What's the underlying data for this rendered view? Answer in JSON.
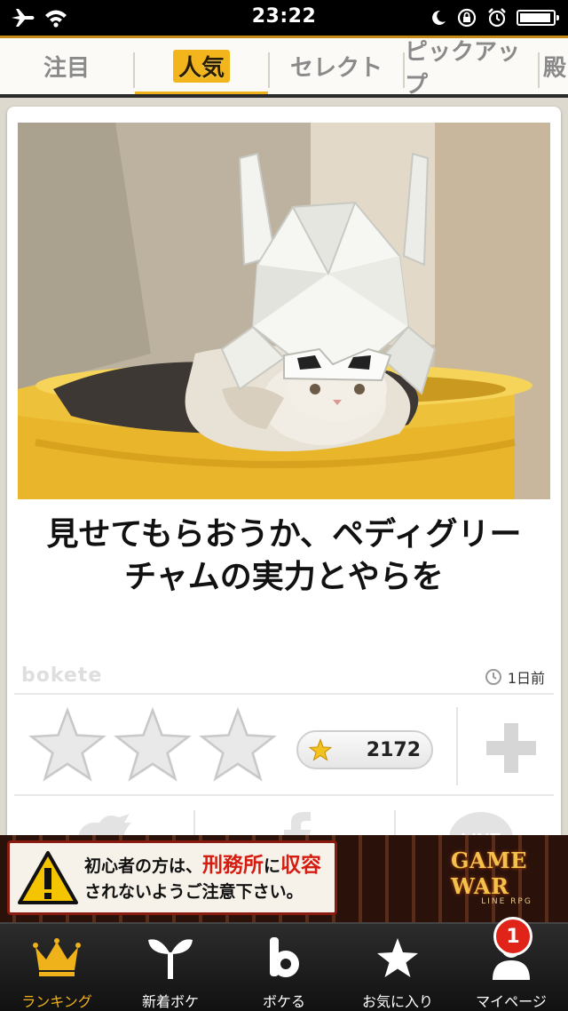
{
  "status_bar": {
    "time": "23:22",
    "icons": [
      "airplane-icon",
      "wifi-icon",
      "moon-icon",
      "rotation-lock-icon",
      "alarm-icon",
      "battery-icon"
    ]
  },
  "top_tabs": {
    "items": [
      {
        "label": "注目",
        "active": false
      },
      {
        "label": "人気",
        "active": true
      },
      {
        "label": "セレクト",
        "active": false
      },
      {
        "label": "ピックアップ",
        "active": false
      },
      {
        "label": "殿",
        "active": false
      }
    ]
  },
  "post": {
    "image_alt": "cat wearing a folded paper samurai helmet lying in a yellow bucket",
    "caption": "見せてもらおうか、ペディグリーチャムの実力とやらを",
    "brand": "bokete",
    "time_ago": "1日前",
    "rating_stars": 3,
    "star_count": "2172"
  },
  "share": {
    "icons": [
      "twitter-icon",
      "facebook-icon",
      "line-icon"
    ]
  },
  "ad": {
    "line1_prefix": "初心者の方は、",
    "line1_highlight": "刑務所",
    "line1_mid": "に",
    "line1_highlight2": "収容",
    "line2": "されないようご注意下さい。",
    "logo": "GAME WAR",
    "logo_sub": "LINE RPG"
  },
  "bottom_tabs": {
    "items": [
      {
        "label": "ランキング",
        "icon": "crown-icon",
        "active": true
      },
      {
        "label": "新着ボケ",
        "icon": "sprout-icon",
        "active": false
      },
      {
        "label": "ボケる",
        "icon": "bokete-b-icon",
        "active": false
      },
      {
        "label": "お気に入り",
        "icon": "star-icon",
        "active": false
      },
      {
        "label": "マイページ",
        "icon": "user-icon",
        "active": false,
        "badge": "1"
      }
    ]
  },
  "colors": {
    "accent": "#f0b21a",
    "badge": "#e0241a",
    "tab_bar": "#1a1a1a"
  }
}
